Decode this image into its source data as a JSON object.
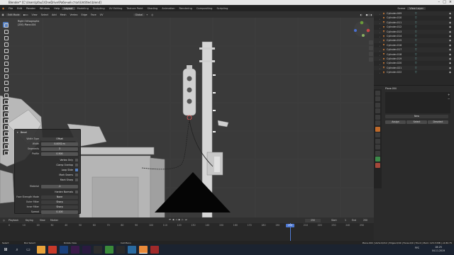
{
  "window": {
    "title": "Blender* [C:\\Users\\pfau1\\OneDrive\\Рабочий стол\\Untitled.blend]"
  },
  "menu": {
    "items": [
      "File",
      "Edit",
      "Render",
      "Window",
      "Help"
    ],
    "workspaces": [
      "Layout",
      "Modeling",
      "Sculpting",
      "UV Editing",
      "Texture Paint",
      "Shading",
      "Animation",
      "Rendering",
      "Compositing",
      "Scripting"
    ],
    "active_workspace": "Layout",
    "scene": "Scene",
    "view_layer": "View Layer"
  },
  "viewport_header": {
    "mode": "Edit Mode",
    "menus": [
      "View",
      "Select",
      "Add",
      "Mesh",
      "Vertex",
      "Edge",
      "Face",
      "UV"
    ],
    "orientation": "Global"
  },
  "viewport": {
    "view_name": "Right Orthographic",
    "object_info": "(250) Plane.004"
  },
  "outliner": {
    "items": [
      "Cylinder.009",
      "Cylinder.010",
      "Cylinder.011",
      "Cylinder.012",
      "Cylinder.013",
      "Cylinder.014",
      "Cylinder.015",
      "Cylinder.016",
      "Cylinder.017",
      "Cylinder.018",
      "Cylinder.019",
      "Cylinder.020",
      "Cylinder.021",
      "Cylinder.022"
    ]
  },
  "properties": {
    "object": "Plane.004",
    "material_field": "New",
    "buttons": [
      "Assign",
      "Select",
      "Deselect"
    ]
  },
  "bevel_panel": {
    "title": "Bevel",
    "rows": [
      {
        "label": "Width Type",
        "value": "Offset"
      },
      {
        "label": "Width",
        "value": "0.0052 m"
      },
      {
        "label": "Segments",
        "value": "3"
      },
      {
        "label": "Profile",
        "value": "0.500"
      }
    ],
    "checks": [
      {
        "label": "Vertex Only",
        "on": false
      },
      {
        "label": "Clamp Overlap",
        "on": false
      },
      {
        "label": "Loop Slide",
        "on": true
      },
      {
        "label": "Mark Seams",
        "on": false
      },
      {
        "label": "Mark Sharp",
        "on": false
      }
    ],
    "rows2": [
      {
        "label": "Material",
        "value": "-1"
      }
    ],
    "harden_normals": "Harden Normals",
    "rows3": [
      {
        "label": "Face Strength Mode",
        "value": "None"
      },
      {
        "label": "Outer Miter",
        "value": "Sharp"
      },
      {
        "label": "Inner Miter",
        "value": "Sharp"
      },
      {
        "label": "Spread",
        "value": "0.100"
      }
    ]
  },
  "timeline": {
    "menus": [
      "Playback",
      "Keying",
      "View",
      "Marker"
    ],
    "current_frame": "250",
    "start_label": "Start",
    "start": "1",
    "end_label": "End",
    "end": "250",
    "ticks": [
      "0",
      "10",
      "20",
      "30",
      "40",
      "50",
      "60",
      "70",
      "80",
      "90",
      "100",
      "110",
      "120",
      "130",
      "140",
      "150",
      "160",
      "170",
      "180",
      "190",
      "200",
      "210",
      "220",
      "230",
      "240",
      "250"
    ]
  },
  "status_bar": {
    "left": "Select",
    "left2": "Box Select",
    "mid": "Rotate View",
    "mid2": "Call Menu",
    "right": "Plane.004 | Verts:0/212 | Edges:0/40 | Faces:0/0 | Tris:0 | Mem: 123.3 MiB | v2.80.75"
  },
  "taskbar": {
    "clock": "18:25",
    "date": "04.11.2019",
    "lang": "РУС"
  },
  "colors": {
    "accent": "#5680c2",
    "selection_orange": "#e98a3a",
    "viewport_bg": "#3a3a3a"
  }
}
